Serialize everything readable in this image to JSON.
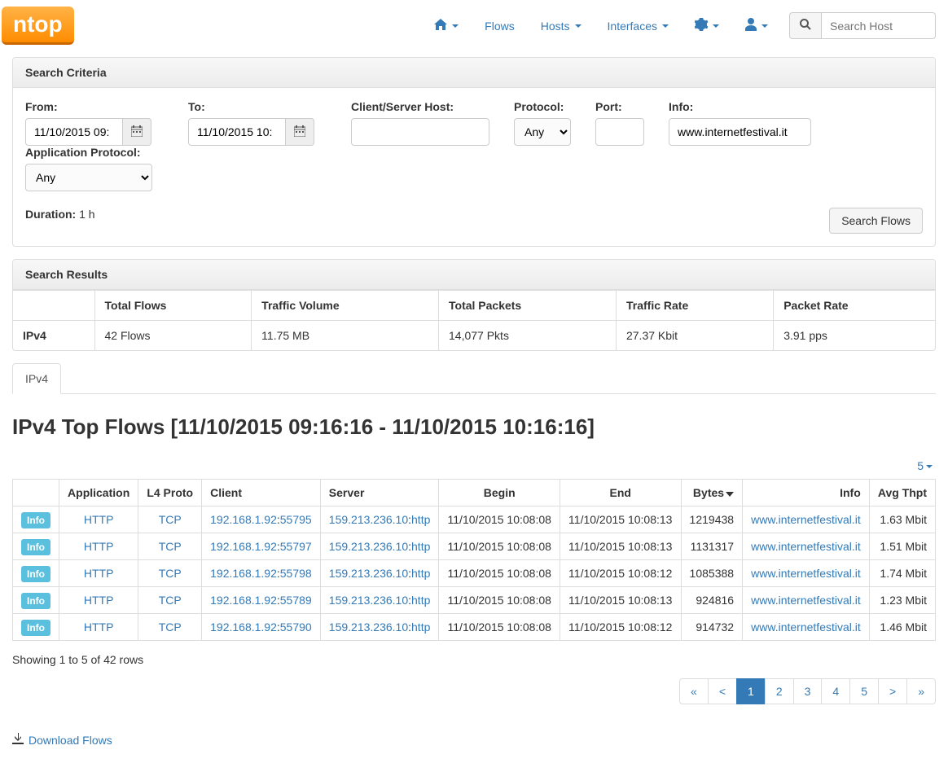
{
  "logo": "ntop",
  "nav": {
    "home": "",
    "flows": "Flows",
    "hosts": "Hosts",
    "interfaces": "Interfaces",
    "search_placeholder": "Search Host"
  },
  "criteria": {
    "heading": "Search Criteria",
    "from_label": "From:",
    "from_value": "11/10/2015 09:",
    "to_label": "To:",
    "to_value": "11/10/2015 10:",
    "host_label": "Client/Server Host:",
    "host_value": "",
    "protocol_label": "Protocol:",
    "protocol_value": "Any",
    "port_label": "Port:",
    "port_value": "",
    "info_label": "Info:",
    "info_value": "www.internetfestival.it",
    "app_protocol_label": "Application Protocol:",
    "app_protocol_value": "Any",
    "duration_label": "Duration:",
    "duration_value": "1 h",
    "search_button": "Search Flows"
  },
  "results": {
    "heading": "Search Results",
    "headers": [
      "",
      "Total Flows",
      "Traffic Volume",
      "Total Packets",
      "Traffic Rate",
      "Packet Rate"
    ],
    "row_label": "IPv4",
    "row": [
      "42 Flows",
      "11.75 MB",
      "14,077 Pkts",
      "27.37 Kbit",
      "3.91 pps"
    ]
  },
  "tabs": {
    "ipv4": "IPv4"
  },
  "top_flows": {
    "title": "IPv4 Top Flows [11/10/2015 09:16:16 - 11/10/2015 10:16:16]",
    "page_size": "5",
    "headers": {
      "application": "Application",
      "l4proto": "L4 Proto",
      "client": "Client",
      "server": "Server",
      "begin": "Begin",
      "end": "End",
      "bytes": "Bytes",
      "info": "Info",
      "avg_thpt": "Avg Thpt"
    },
    "info_badge": "Info",
    "rows": [
      {
        "application": "HTTP",
        "l4proto": "TCP",
        "client_ip": "192.168.1.92",
        "client_port": "55795",
        "server_ip": "159.213.236.10",
        "server_port": "http",
        "begin": "11/10/2015 10:08:08",
        "end": "11/10/2015 10:08:13",
        "bytes": "1219438",
        "info": "www.internetfestival.it",
        "avg_thpt": "1.63 Mbit"
      },
      {
        "application": "HTTP",
        "l4proto": "TCP",
        "client_ip": "192.168.1.92",
        "client_port": "55797",
        "server_ip": "159.213.236.10",
        "server_port": "http",
        "begin": "11/10/2015 10:08:08",
        "end": "11/10/2015 10:08:13",
        "bytes": "1131317",
        "info": "www.internetfestival.it",
        "avg_thpt": "1.51 Mbit"
      },
      {
        "application": "HTTP",
        "l4proto": "TCP",
        "client_ip": "192.168.1.92",
        "client_port": "55798",
        "server_ip": "159.213.236.10",
        "server_port": "http",
        "begin": "11/10/2015 10:08:08",
        "end": "11/10/2015 10:08:12",
        "bytes": "1085388",
        "info": "www.internetfestival.it",
        "avg_thpt": "1.74 Mbit"
      },
      {
        "application": "HTTP",
        "l4proto": "TCP",
        "client_ip": "192.168.1.92",
        "client_port": "55789",
        "server_ip": "159.213.236.10",
        "server_port": "http",
        "begin": "11/10/2015 10:08:08",
        "end": "11/10/2015 10:08:13",
        "bytes": "924816",
        "info": "www.internetfestival.it",
        "avg_thpt": "1.23 Mbit"
      },
      {
        "application": "HTTP",
        "l4proto": "TCP",
        "client_ip": "192.168.1.92",
        "client_port": "55790",
        "server_ip": "159.213.236.10",
        "server_port": "http",
        "begin": "11/10/2015 10:08:08",
        "end": "11/10/2015 10:08:12",
        "bytes": "914732",
        "info": "www.internetfestival.it",
        "avg_thpt": "1.46 Mbit"
      }
    ],
    "showing": "Showing 1 to 5 of 42 rows",
    "pages": [
      "«",
      "<",
      "1",
      "2",
      "3",
      "4",
      "5",
      ">",
      "»"
    ],
    "active_page": "1"
  },
  "download": "Download Flows"
}
